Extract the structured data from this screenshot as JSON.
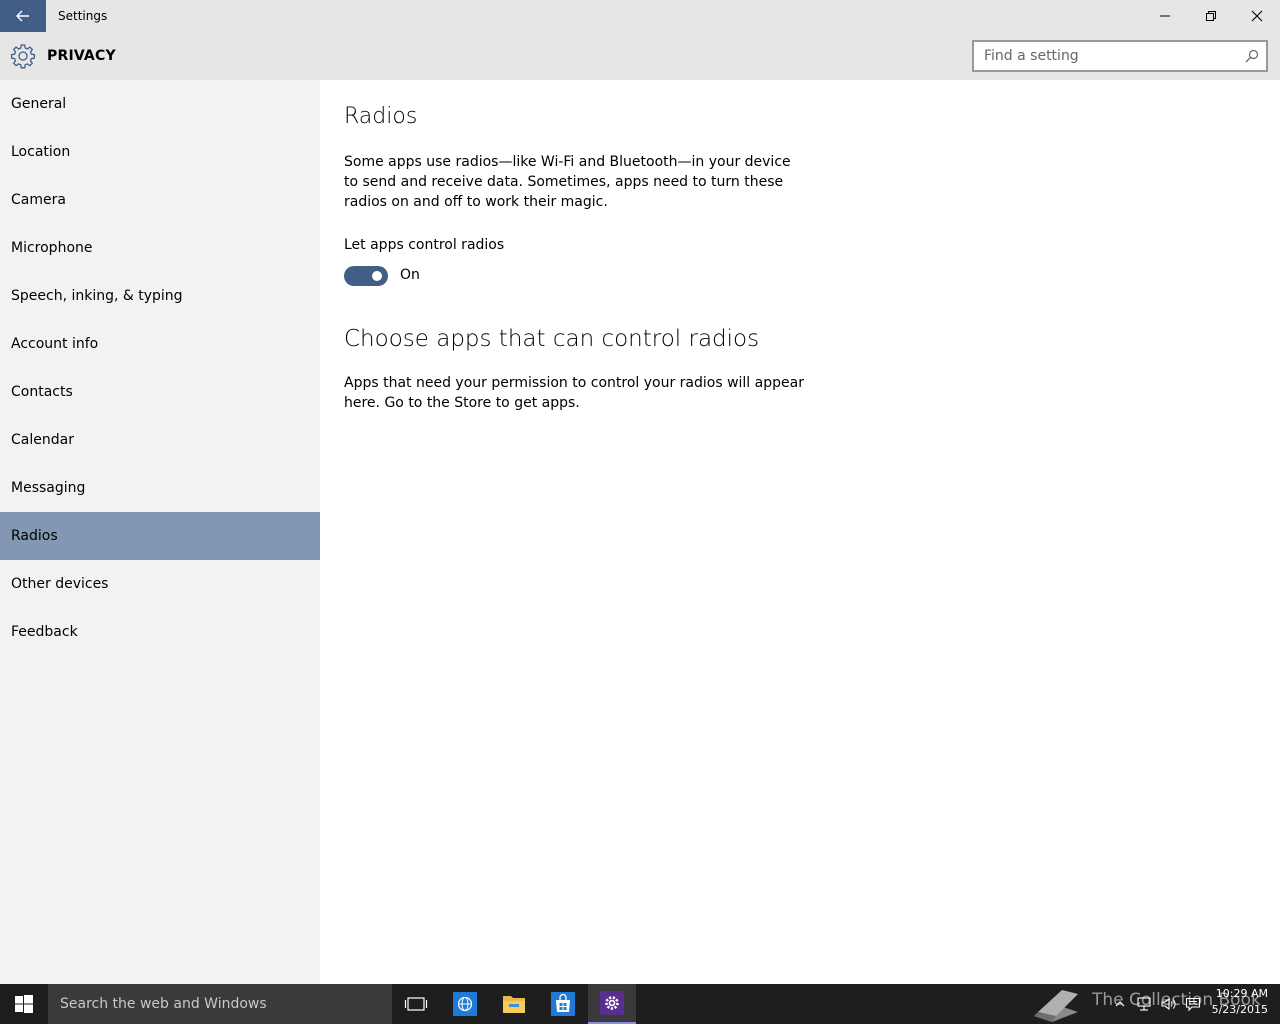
{
  "window": {
    "title": "Settings"
  },
  "header": {
    "section": "PRIVACY",
    "search_placeholder": "Find a setting"
  },
  "sidebar": {
    "items": [
      {
        "label": "General"
      },
      {
        "label": "Location"
      },
      {
        "label": "Camera"
      },
      {
        "label": "Microphone"
      },
      {
        "label": "Speech, inking, & typing"
      },
      {
        "label": "Account info"
      },
      {
        "label": "Contacts"
      },
      {
        "label": "Calendar"
      },
      {
        "label": "Messaging"
      },
      {
        "label": "Radios",
        "selected": true
      },
      {
        "label": "Other devices"
      },
      {
        "label": "Feedback"
      }
    ]
  },
  "main": {
    "title": "Radios",
    "description": "Some apps use radios—like Wi-Fi and Bluetooth—in your device to send and receive data. Sometimes, apps need to turn these radios on and off to work their magic.",
    "toggle_label": "Let apps control radios",
    "toggle_state": "On",
    "toggle_on": true,
    "section_title": "Choose apps that can control radios",
    "section_text": "Apps that need your permission to control your radios will appear here. Go to the Store to get apps."
  },
  "taskbar": {
    "search_placeholder": "Search the web and Windows",
    "watermark": "The Collection Book",
    "time": "10:29 AM",
    "date": "5/23/2015"
  },
  "colors": {
    "accent": "#435e86",
    "selected_item": "#8197b2",
    "chrome": "#e6e6e6",
    "sidebar": "#f2f2f2",
    "taskbar": "#1e1e1e"
  },
  "icons": {
    "back": "back-arrow-icon",
    "minimize": "minimize-icon",
    "restore": "restore-icon",
    "close": "close-icon",
    "gear": "gear-icon",
    "search": "search-icon",
    "start": "windows-logo-icon",
    "task_view": "task-view-icon",
    "edge": "edge-icon",
    "explorer": "file-explorer-icon",
    "store": "store-icon",
    "settings": "settings-gear-icon",
    "tray_chevron": "chevron-up-icon",
    "network": "network-icon",
    "volume": "volume-icon",
    "action_center": "action-center-icon",
    "book": "book-icon"
  }
}
